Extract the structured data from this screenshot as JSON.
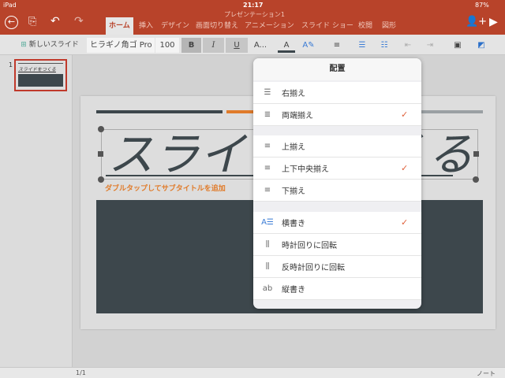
{
  "status": {
    "device": "iPad",
    "time": "21:17",
    "battery": "87%"
  },
  "title": "プレゼンテーション1",
  "tabs": [
    "ホーム",
    "挿入",
    "デザイン",
    "画面切り替え",
    "アニメーション",
    "スライド ショー",
    "校閲",
    "図形"
  ],
  "toolbar": {
    "new_slide": "新しいスライド",
    "font": "ヒラギノ角ゴ Pro",
    "size": "100",
    "bold": "B",
    "italic": "I",
    "underline": "U",
    "more": "A...",
    "font_color": "A"
  },
  "thumb": {
    "number": "1",
    "title": "スライドをつくる"
  },
  "slide": {
    "title": "スライドをつくる",
    "subtitle": "ダブルタップしてサブタイトルを追加"
  },
  "popover": {
    "title": "配置",
    "group1": [
      {
        "label": "右揃え",
        "checked": false
      },
      {
        "label": "両端揃え",
        "checked": true
      }
    ],
    "group2": [
      {
        "label": "上揃え",
        "checked": false
      },
      {
        "label": "上下中央揃え",
        "checked": true
      },
      {
        "label": "下揃え",
        "checked": false
      }
    ],
    "group3": [
      {
        "label": "横書き",
        "checked": true
      },
      {
        "label": "時計回りに回転",
        "checked": false
      },
      {
        "label": "反時計回りに回転",
        "checked": false
      },
      {
        "label": "縦書き",
        "checked": false
      }
    ],
    "check": "✓"
  },
  "bottom": {
    "page": "1/1",
    "notes": "ノート"
  },
  "colors": {
    "brand": "#b8432a",
    "accent": "#e07b2a",
    "dark": "#3d474c"
  }
}
